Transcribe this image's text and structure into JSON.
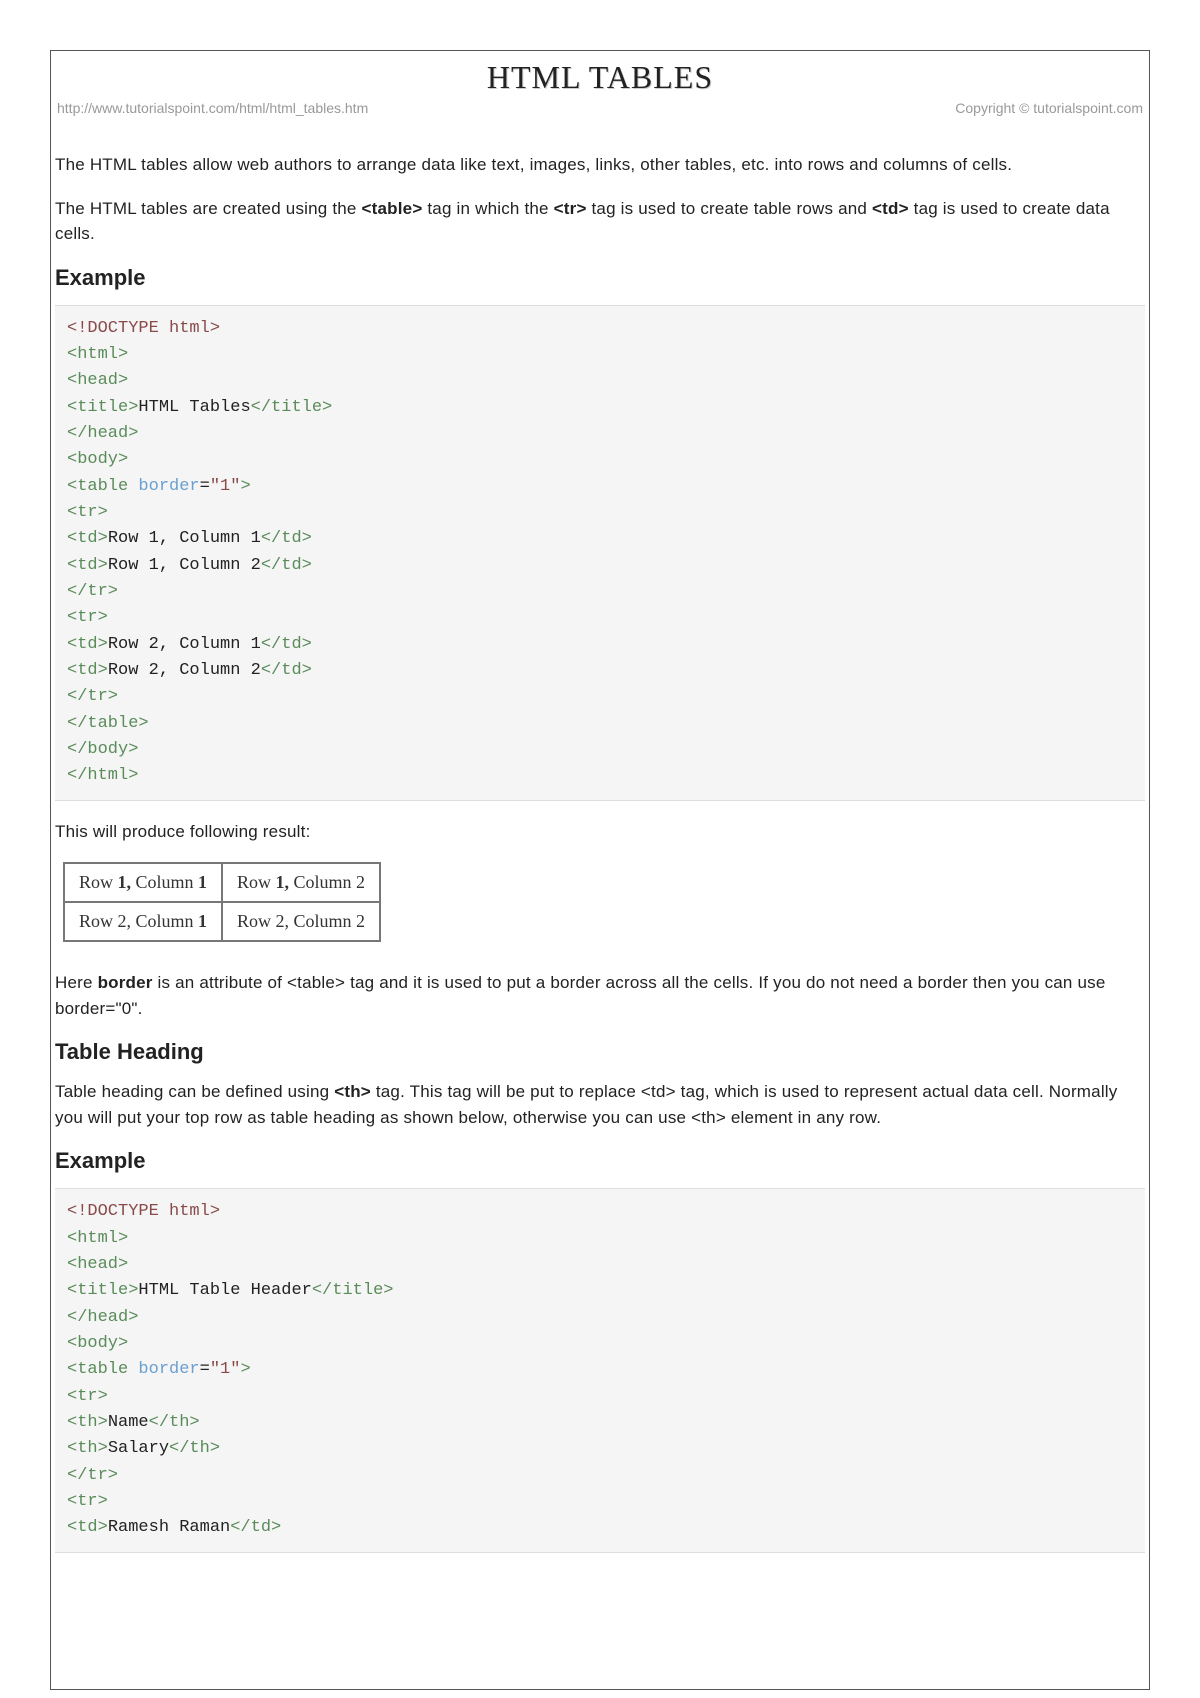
{
  "title": "HTML TABLES",
  "source_url": "http://www.tutorialspoint.com/html/html_tables.htm",
  "copyright": "Copyright © tutorialspoint.com",
  "intro_p1": "The HTML tables allow web authors to arrange data like text, images, links, other tables, etc. into rows and columns of cells.",
  "intro_p2_pre": "The HTML tables are created using the ",
  "intro_p2_tag1": "<table>",
  "intro_p2_mid1": " tag in which the ",
  "intro_p2_tag2": "<tr>",
  "intro_p2_mid2": " tag is used to create table rows and ",
  "intro_p2_tag3": "<td>",
  "intro_p2_post": " tag is used to create data cells.",
  "h_example1": "Example",
  "code1": {
    "c1": "<!DOCTYPE html>",
    "c2": "<html>",
    "c3": "<head>",
    "c4o": "<title>",
    "c4t": "HTML Tables",
    "c4c": "</title>",
    "c5": "</head>",
    "c6": "<body>",
    "c7o": "<table",
    "c7a": " border",
    "c7e": "=",
    "c7v": "\"1\"",
    "c7c": ">",
    "c8": "<tr>",
    "c9o": "<td>",
    "c9t": "Row 1, Column 1",
    "c9c": "</td>",
    "c10o": "<td>",
    "c10t": "Row 1, Column 2",
    "c10c": "</td>",
    "c11": "</tr>",
    "c12": "<tr>",
    "c13o": "<td>",
    "c13t": "Row 2, Column 1",
    "c13c": "</td>",
    "c14o": "<td>",
    "c14t": "Row 2, Column 2",
    "c14c": "</td>",
    "c15": "</tr>",
    "c16": "</table>",
    "c17": "</body>",
    "c18": "</html>"
  },
  "result_intro": "This will produce following result:",
  "result_table": {
    "r1c1_pre": "Row ",
    "r1c1_b": "1,",
    "r1c1_post": " Column ",
    "r1c1_b2": "1",
    "r1c2_pre": "Row ",
    "r1c2_b": "1,",
    "r1c2_post": " Column 2",
    "r2c1_pre": "Row 2, Column ",
    "r2c1_b": "1",
    "r2c2": "Row 2, Column 2"
  },
  "border_p_pre": "Here ",
  "border_p_bold": "border",
  "border_p_post": " is an attribute of <table> tag and it is used to put a border across all the cells. If you do not need a border then you can use border=\"0\".",
  "h_tableheading": "Table Heading",
  "th_p_pre": "Table heading can be defined using ",
  "th_p_bold": "<th>",
  "th_p_post": " tag. This tag will be put to replace <td> tag, which is used to represent actual data cell. Normally you will put your top row as table heading as shown below, otherwise you can use <th> element in any row.",
  "h_example2": "Example",
  "code2": {
    "c1": "<!DOCTYPE html>",
    "c2": "<html>",
    "c3": "<head>",
    "c4o": "<title>",
    "c4t": "HTML Table Header",
    "c4c": "</title>",
    "c5": "</head>",
    "c6": "<body>",
    "c7o": "<table",
    "c7a": " border",
    "c7e": "=",
    "c7v": "\"1\"",
    "c7c": ">",
    "c8": "<tr>",
    "c9o": "<th>",
    "c9t": "Name",
    "c9c": "</th>",
    "c10o": "<th>",
    "c10t": "Salary",
    "c10c": "</th>",
    "c11": "</tr>",
    "c12": "<tr>",
    "c13o": "<td>",
    "c13t": "Ramesh Raman",
    "c13c": "</td>"
  }
}
